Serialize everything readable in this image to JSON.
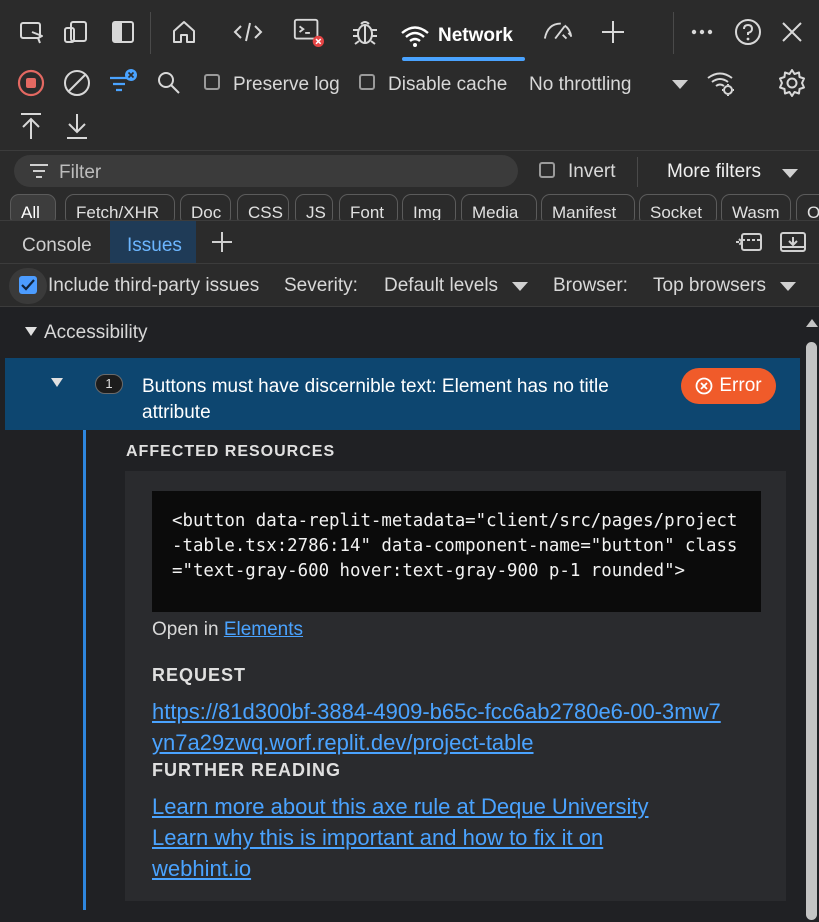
{
  "top_tabs": {
    "network_label": "Network"
  },
  "toolbar": {
    "preserve_log": "Preserve log",
    "disable_cache": "Disable cache",
    "throttling": "No throttling"
  },
  "filter": {
    "placeholder": "Filter",
    "invert": "Invert",
    "more_filters": "More filters"
  },
  "chips": [
    "All",
    "Fetch/XHR",
    "Doc",
    "CSS",
    "JS",
    "Font",
    "Img",
    "Media",
    "Manifest",
    "Socket",
    "Wasm",
    "O"
  ],
  "drawer": {
    "tabs": [
      "Console",
      "Issues"
    ]
  },
  "issue_options": {
    "include_third_party": "Include third-party issues",
    "severity_label": "Severity:",
    "severity_value": "Default levels",
    "browser_label": "Browser:",
    "browser_value": "Top browsers"
  },
  "issues": {
    "category": "Accessibility",
    "count": "1",
    "title_line1": "Buttons must have discernible text: Element has no title",
    "title_line2": "attribute",
    "badge": "Error",
    "affected_heading": "AFFECTED RESOURCES",
    "code": "<button data-replit-metadata=\"client/src/pages/project-table.tsx:2786:14\" data-component-name=\"button\" class=\"text-gray-600 hover:text-gray-900 p-1 rounded\">",
    "open_in": "Open in",
    "elements_link": "Elements",
    "request_heading": "REQUEST",
    "request_url_line1": "https://81d300bf-3884-4909-b65c-fcc6ab2780e6-00-3mw7",
    "request_url_line2": "yn7a29zwq.worf.replit.dev/project-table",
    "further_heading": "FURTHER READING",
    "link1": "Learn more about this axe rule at Deque University",
    "link2_line1": "Learn why this is important and how to fix it on",
    "link2_line2": "webhint.io"
  },
  "colors": {
    "accent": "#4aa3ff",
    "issue_row": "#0d4670",
    "error_badge": "#f05b2a"
  }
}
